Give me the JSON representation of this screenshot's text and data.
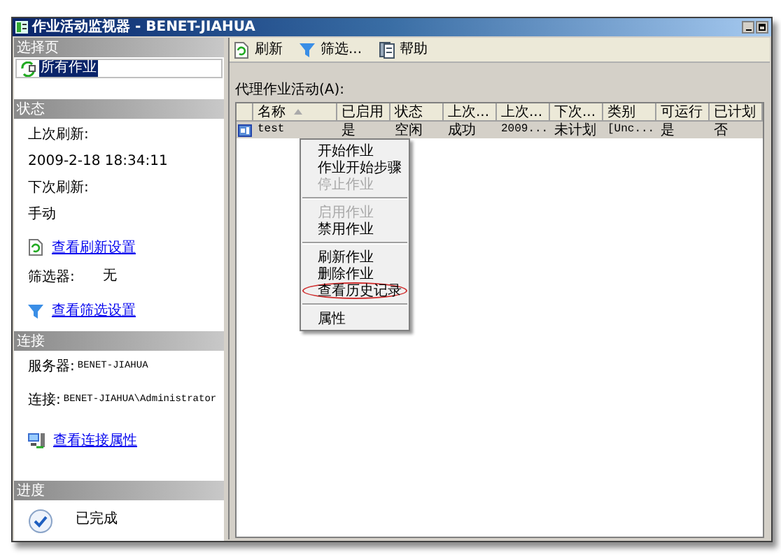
{
  "window": {
    "title": "作业活动监视器 - BENET-JIAHUA"
  },
  "left_pane": {
    "sections": [
      {
        "title": "选择页",
        "items": [
          {
            "kind": "page",
            "text": "所有作业",
            "selected": true
          }
        ]
      },
      {
        "title": "状态",
        "items": [
          {
            "kind": "text",
            "text": "上次刷新:"
          },
          {
            "kind": "text",
            "text": "2009-2-18 18:34:11"
          },
          {
            "kind": "text",
            "text": "下次刷新:"
          },
          {
            "kind": "text",
            "text": "手动"
          },
          {
            "kind": "refresh_link",
            "text": "查看刷新设置"
          },
          {
            "kind": "pair",
            "label": "筛选器:",
            "value": "无"
          },
          {
            "kind": "filter_link",
            "text": "查看筛选设置"
          }
        ]
      },
      {
        "title": "连接",
        "items": [
          {
            "kind": "pair",
            "label": "服务器:",
            "value": "BENET-JIAHUA"
          },
          {
            "kind": "pair",
            "label": "连接:",
            "value": "BENET-JIAHUA\\Administrator"
          },
          {
            "kind": "connection_link",
            "text": "查看连接属性"
          }
        ]
      },
      {
        "title": "进度",
        "items": [
          {
            "kind": "done",
            "text": "已完成"
          }
        ]
      }
    ]
  },
  "toolbar": [
    {
      "kind": "refresh",
      "label": "刷新"
    },
    {
      "kind": "filter",
      "label": "筛选..."
    },
    {
      "kind": "help",
      "label": "帮助"
    }
  ],
  "table": {
    "label": "代理作业活动(A):",
    "columns": [
      {
        "label": "名称",
        "sorted": true
      },
      {
        "label": "已启用",
        "sorted": false
      },
      {
        "label": "状态",
        "sorted": false
      },
      {
        "label": "上次...",
        "sorted": false
      },
      {
        "label": "上次...",
        "sorted": false
      },
      {
        "label": "下次...",
        "sorted": false
      },
      {
        "label": "类别",
        "sorted": false
      },
      {
        "label": "可运行",
        "sorted": false
      },
      {
        "label": "已计划",
        "sorted": false
      }
    ],
    "rows": [
      {
        "selected": true,
        "cells": [
          "test",
          "是",
          "空闲",
          "成功",
          "2009...",
          "未计划",
          "[Unc...",
          "是",
          "否"
        ]
      }
    ]
  },
  "context_menu": [
    {
      "kind": "item",
      "label": "开始作业",
      "disabled": false,
      "highlighted": false
    },
    {
      "kind": "item",
      "label": "作业开始步骤",
      "disabled": false,
      "highlighted": false
    },
    {
      "kind": "item",
      "label": "停止作业",
      "disabled": true,
      "highlighted": false
    },
    {
      "kind": "separator"
    },
    {
      "kind": "item",
      "label": "启用作业",
      "disabled": true,
      "highlighted": false
    },
    {
      "kind": "item",
      "label": "禁用作业",
      "disabled": false,
      "highlighted": false
    },
    {
      "kind": "separator"
    },
    {
      "kind": "item",
      "label": "刷新作业",
      "disabled": false,
      "highlighted": false
    },
    {
      "kind": "item",
      "label": "删除作业",
      "disabled": false,
      "highlighted": false
    },
    {
      "kind": "item",
      "label": "查看历史记录",
      "disabled": false,
      "highlighted": true
    },
    {
      "kind": "separator"
    },
    {
      "kind": "item",
      "label": "属性",
      "disabled": false,
      "highlighted": false
    }
  ]
}
